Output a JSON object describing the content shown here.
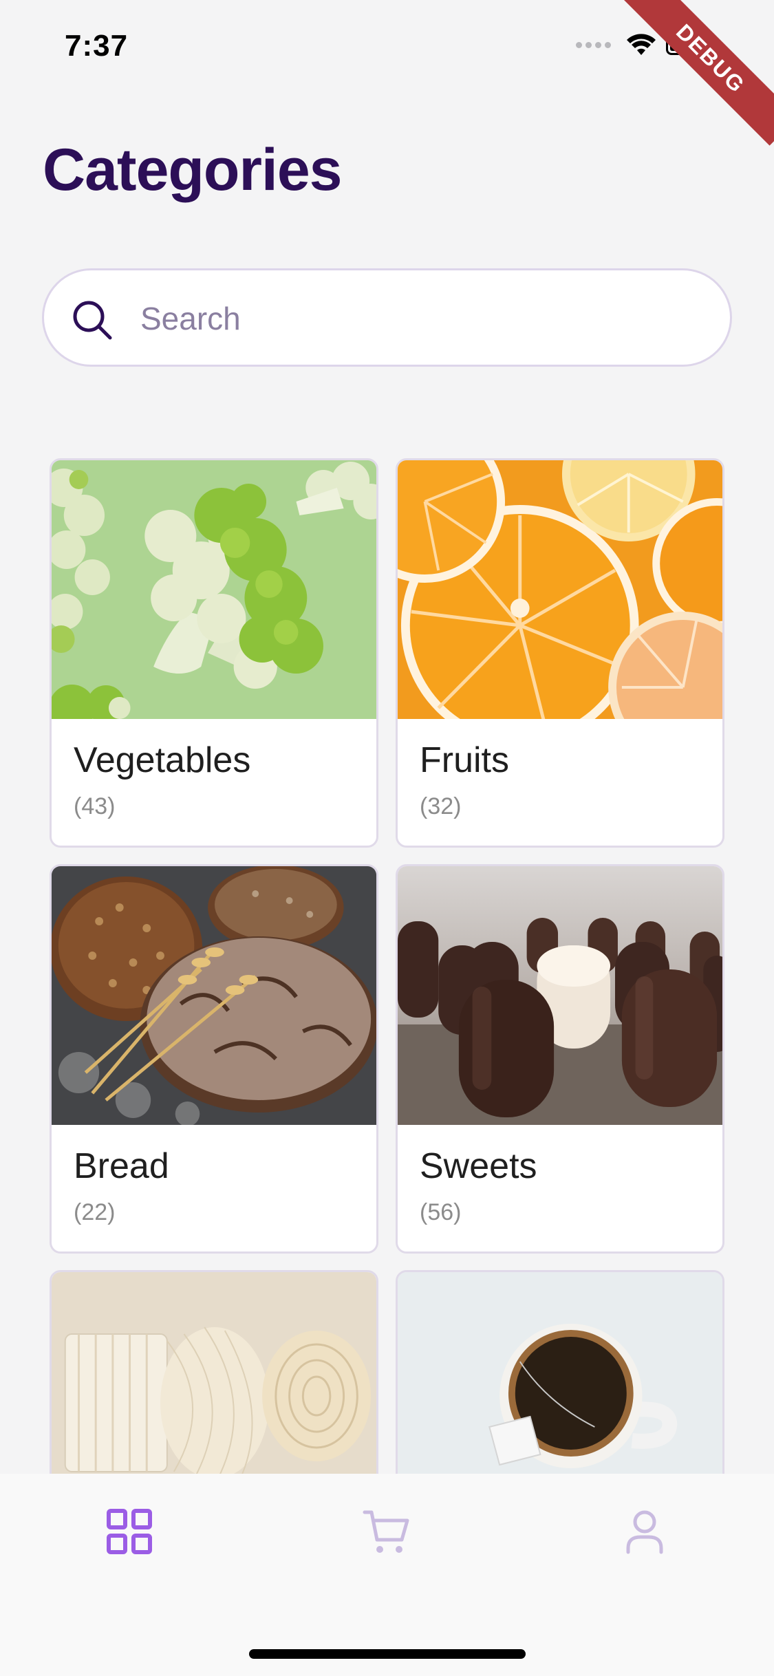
{
  "status_bar": {
    "time": "7:37",
    "debug_label": "DEBUG"
  },
  "header": {
    "title": "Categories"
  },
  "search": {
    "placeholder": "Search",
    "icon": "search-icon"
  },
  "categories": [
    {
      "name": "Vegetables",
      "count": "(43)",
      "image": "broccoli"
    },
    {
      "name": "Fruits",
      "count": "(32)",
      "image": "orange-slices"
    },
    {
      "name": "Bread",
      "count": "(22)",
      "image": "bread-loaves"
    },
    {
      "name": "Sweets",
      "count": "(56)",
      "image": "chocolate-marshmallows"
    },
    {
      "name": "",
      "count": "",
      "image": "pasta"
    },
    {
      "name": "",
      "count": "",
      "image": "tea-cup"
    }
  ],
  "bottom_nav": {
    "items": [
      {
        "icon": "grid-icon",
        "active": true
      },
      {
        "icon": "cart-icon",
        "active": false
      },
      {
        "icon": "user-icon",
        "active": false
      }
    ],
    "active_color": "#9b5de5",
    "inactive_color": "#c9bbe0"
  },
  "colors": {
    "title": "#2c0f57",
    "background": "#f4f4f5",
    "card_border": "#e0dae9"
  }
}
